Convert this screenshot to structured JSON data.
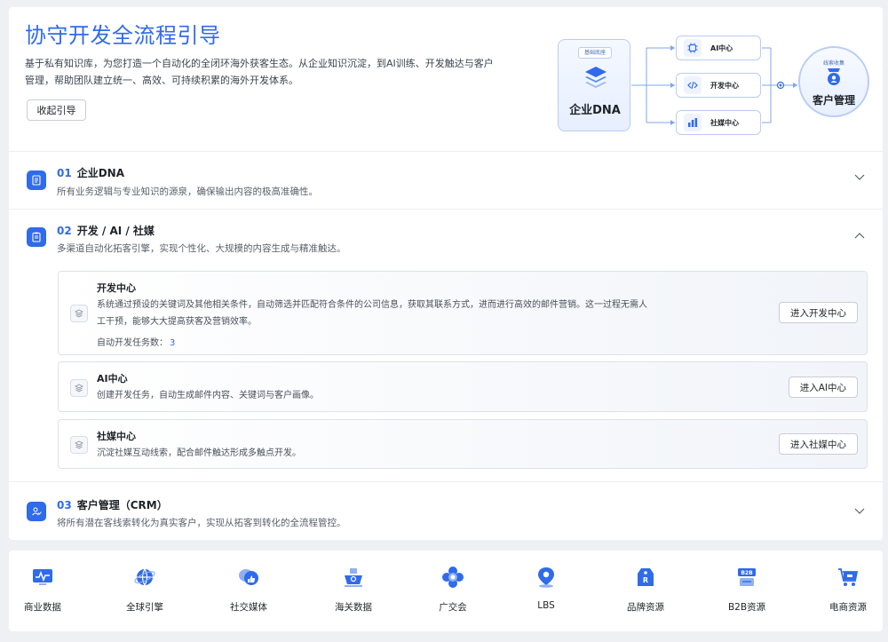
{
  "hero": {
    "title": "协守开发全流程引导",
    "description": "基于私有知识库，为您打造一个自动化的全闭环海外获客生态。从企业知识沉淀，到AI训练、开发触达与客户管理，帮助团队建立统一、高效、可持续积累的海外开发体系。",
    "collapse_label": "收起引导"
  },
  "diagram": {
    "dna_tag": "基础底座",
    "dna_name": "企业DNA",
    "hubs": [
      "AI中心",
      "开发中心",
      "社媒中心"
    ],
    "circle_tag": "线索收集",
    "circle_name": "客户管理"
  },
  "steps": [
    {
      "num": "01",
      "title": "企业DNA",
      "desc": "所有业务逻辑与专业知识的源泉，确保输出内容的极高准确性。",
      "expanded": false
    },
    {
      "num": "02",
      "title": "开发 / AI / 社媒",
      "desc": "多渠道自动化拓客引擎，实现个性化、大规模的内容生成与精准触达。",
      "expanded": true
    },
    {
      "num": "03",
      "title": "客户管理（CRM）",
      "desc": "将所有潜在客线索转化为真实客户，实现从拓客到转化的全流程管控。",
      "expanded": false
    }
  ],
  "subs": [
    {
      "title": "开发中心",
      "desc": "系统通过预设的关键词及其他相关条件，自动筛选并匹配符合条件的公司信息，获取其联系方式，进而进行高效的邮件营销。这一过程无需人工干预，能够大大提高获客及营销效率。",
      "count_label": "自动开发任务数：",
      "count_value": "3",
      "button": "进入开发中心"
    },
    {
      "title": "AI中心",
      "desc": "创建开发任务，自动生成邮件内容、关键词与客户画像。",
      "button": "进入AI中心"
    },
    {
      "title": "社媒中心",
      "desc": "沉淀社媒互动线索，配合邮件触达形成多触点开发。",
      "button": "进入社媒中心"
    }
  ],
  "tools": [
    {
      "label": "商业数据",
      "icon": "monitor-chart-icon",
      "color": "#2f6bea"
    },
    {
      "label": "全球引擎",
      "icon": "globe-icon",
      "color": "#2f6bea"
    },
    {
      "label": "社交媒体",
      "icon": "chat-like-icon",
      "color": "#2f6bea"
    },
    {
      "label": "海关数据",
      "icon": "cargo-ship-icon",
      "color": "#2f6bea"
    },
    {
      "label": "广交会",
      "icon": "flower-icon",
      "color": "#2f6bea"
    },
    {
      "label": "LBS",
      "icon": "map-pin-icon",
      "color": "#2f6bea"
    },
    {
      "label": "品牌资源",
      "icon": "tag-icon",
      "color": "#2f6bea"
    },
    {
      "label": "B2B资源",
      "icon": "b2b-icon",
      "color": "#2f6bea"
    },
    {
      "label": "电商资源",
      "icon": "cart-icon",
      "color": "#2f6bea"
    }
  ],
  "colors": {
    "accent": "#2f6bea",
    "text": "#1f2329",
    "muted": "#5a606b",
    "border": "#dde2ea"
  }
}
